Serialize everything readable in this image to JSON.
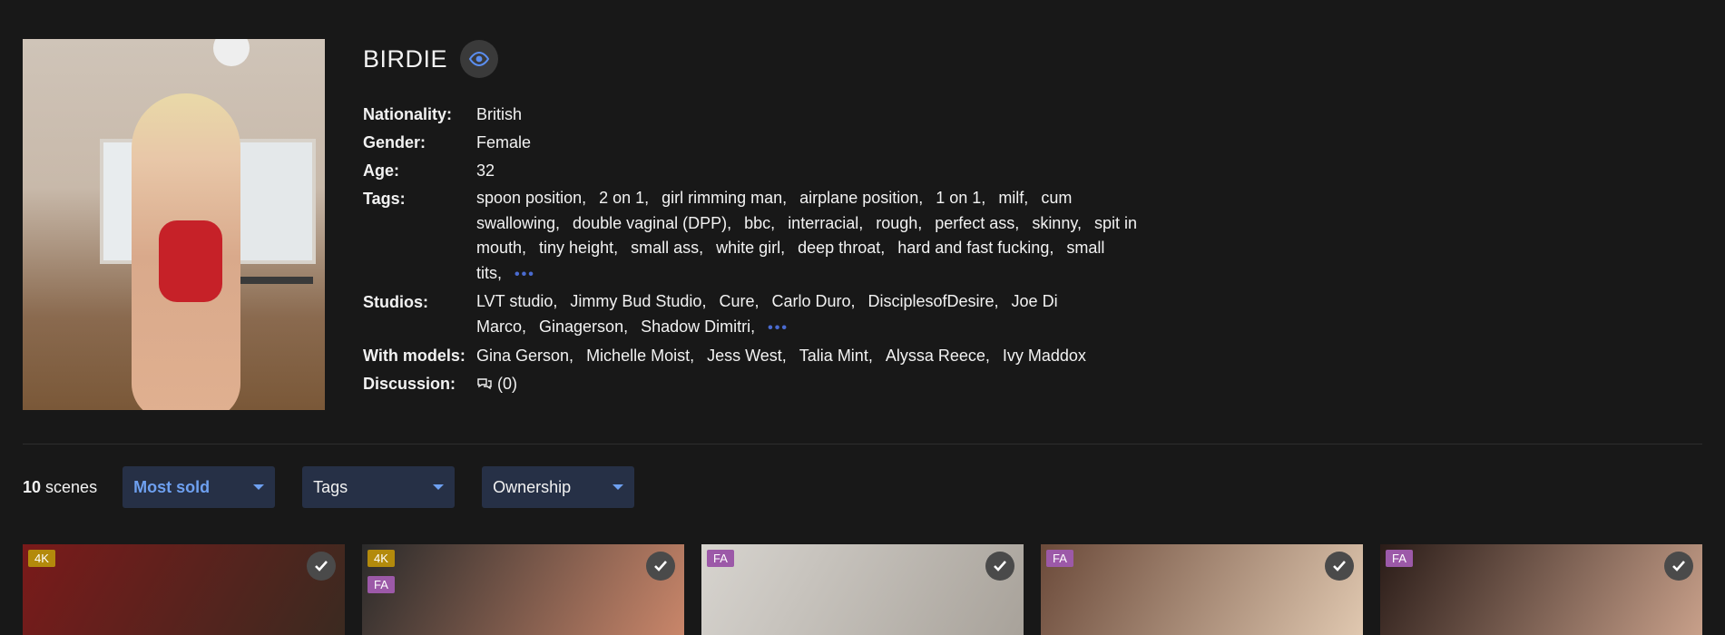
{
  "performer": {
    "name": "BIRDIE"
  },
  "details": {
    "nationality_label": "Nationality:",
    "nationality": "British",
    "gender_label": "Gender:",
    "gender": "Female",
    "age_label": "Age:",
    "age": "32",
    "tags_label": "Tags:",
    "tags": [
      "spoon position,",
      "2 on 1,",
      "girl rimming man,",
      "airplane position,",
      "1 on 1,",
      "milf,",
      "cum swallowing,",
      "double vaginal (DPP),",
      "bbc,",
      "interracial,",
      "rough,",
      "perfect ass,",
      "skinny,",
      "spit in mouth,",
      "tiny height,",
      "small ass,",
      "white girl,",
      "deep throat,",
      "hard and fast fucking,",
      "small tits,"
    ],
    "studios_label": "Studios:",
    "studios": [
      "LVT studio,",
      "Jimmy Bud Studio,",
      "Cure,",
      "Carlo Duro,",
      "DisciplesofDesire,",
      "Joe Di Marco,",
      "Ginagerson,",
      "Shadow Dimitri,"
    ],
    "models_label": "With models:",
    "models": [
      "Gina Gerson,",
      "Michelle Moist,",
      "Jess West,",
      "Talia Mint,",
      "Alyssa Reece,",
      "Ivy Maddox"
    ],
    "discussion_label": "Discussion:",
    "discussion_count": "(0)",
    "more_glyph": "•••"
  },
  "filters": {
    "count": "10",
    "count_suffix": " scenes",
    "sort": "Most sold",
    "tags": "Tags",
    "ownership": "Ownership"
  },
  "scenes": [
    {
      "badges": [
        "4K"
      ],
      "colors": [
        "#7a1a1a",
        "#3b2a20"
      ]
    },
    {
      "badges": [
        "4K",
        "FA"
      ],
      "colors": [
        "#2a2a2a",
        "#c9866a"
      ]
    },
    {
      "badges": [
        "FA"
      ],
      "colors": [
        "#d7d4cf",
        "#a8a29a"
      ]
    },
    {
      "badges": [
        "FA"
      ],
      "colors": [
        "#6b4a3a",
        "#e0c8b0"
      ]
    },
    {
      "badges": [
        "FA"
      ],
      "colors": [
        "#2a1c18",
        "#c8a08a"
      ]
    }
  ]
}
